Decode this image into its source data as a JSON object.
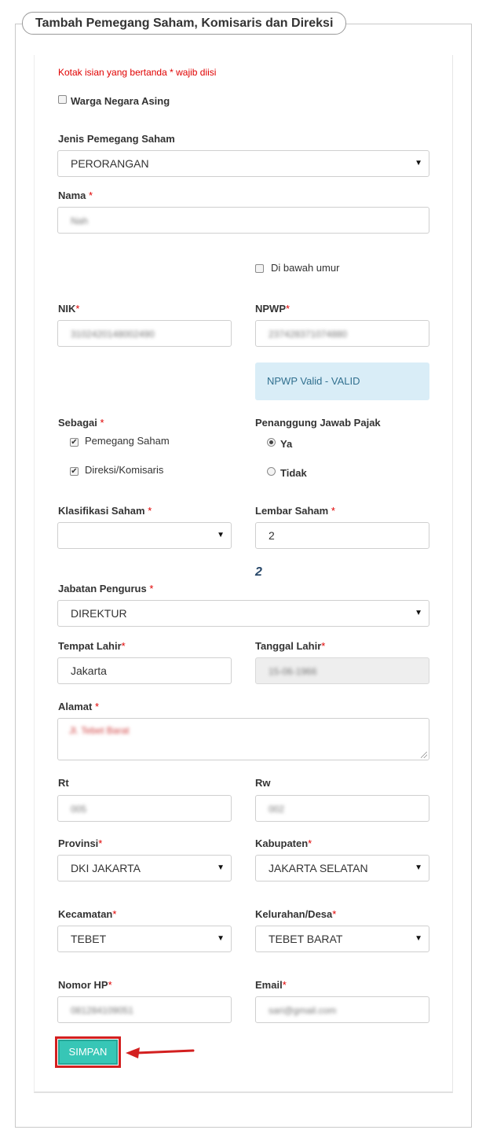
{
  "form": {
    "title": "Tambah Pemegang Saham, Komisaris dan Direksi",
    "required_note": "Kotak isian yang bertanda * wajib diisi",
    "required_marker": "*",
    "foreign_citizen_label": "Warga Negara Asing",
    "shareholder_type": {
      "label": "Jenis Pemegang Saham",
      "value": "PERORANGAN"
    },
    "nama": {
      "label": "Nama",
      "value": "Nah"
    },
    "under_age_label": "Di bawah umur",
    "nik": {
      "label": "NIK",
      "value": "3102420148002490"
    },
    "npwp": {
      "label": "NPWP",
      "value": "237428371074880"
    },
    "npwp_status": "NPWP Valid - VALID",
    "sebagai": {
      "label": "Sebagai",
      "options": [
        {
          "label": "Pemegang Saham",
          "checked": true
        },
        {
          "label": "Direksi/Komisaris",
          "checked": true
        }
      ]
    },
    "tax_responsible": {
      "label": "Penanggung Jawab Pajak",
      "options": [
        {
          "label": "Ya",
          "selected": true
        },
        {
          "label": "Tidak",
          "selected": false
        }
      ]
    },
    "klasifikasi_saham": {
      "label": "Klasifikasi Saham",
      "value": ""
    },
    "lembar_saham": {
      "label": "Lembar Saham",
      "value": "2",
      "display": "2"
    },
    "jabatan": {
      "label": "Jabatan Pengurus",
      "value": "DIREKTUR"
    },
    "tempat_lahir": {
      "label": "Tempat Lahir",
      "value": "Jakarta"
    },
    "tanggal_lahir": {
      "label": "Tanggal Lahir",
      "value": "15-06-1966"
    },
    "alamat": {
      "label": "Alamat",
      "value": "Jl. Tebet Barat"
    },
    "rt": {
      "label": "Rt",
      "value": "005"
    },
    "rw": {
      "label": "Rw",
      "value": "002"
    },
    "provinsi": {
      "label": "Provinsi",
      "value": "DKI JAKARTA"
    },
    "kabupaten": {
      "label": "Kabupaten",
      "value": "JAKARTA SELATAN"
    },
    "kecamatan": {
      "label": "Kecamatan",
      "value": "TEBET"
    },
    "kelurahan": {
      "label": "Kelurahan/Desa",
      "value": "TEBET BARAT"
    },
    "nomor_hp": {
      "label": "Nomor HP",
      "value": "081284109051"
    },
    "email": {
      "label": "Email",
      "value": "sari@gmail.com"
    },
    "submit_label": "SIMPAN"
  },
  "icons": {
    "select_caret": "▼",
    "checkmark": "✔",
    "arrow": "red-arrow-left-icon"
  },
  "colors": {
    "required": "#e00000",
    "button_bg": "#37c6b6",
    "highlight": "#d32020",
    "alert_bg": "#d9edf7",
    "alert_text": "#31708f"
  }
}
